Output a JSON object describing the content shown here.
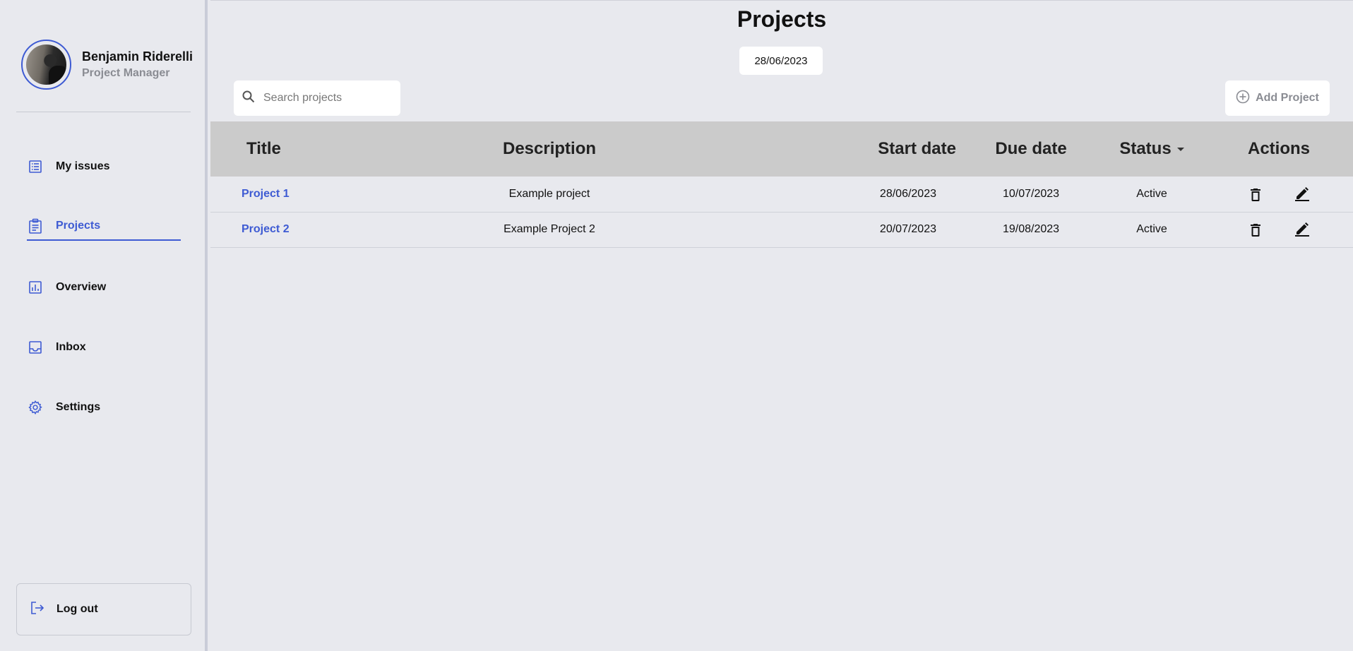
{
  "profile": {
    "name": "Benjamin Riderelli",
    "role": "Project Manager"
  },
  "sidebar": {
    "items": [
      {
        "label": "My issues",
        "icon": "list-icon"
      },
      {
        "label": "Projects",
        "icon": "clipboard-icon",
        "active": true
      },
      {
        "label": "Overview",
        "icon": "bar-chart-icon"
      },
      {
        "label": "Inbox",
        "icon": "inbox-icon"
      },
      {
        "label": "Settings",
        "icon": "gear-icon"
      }
    ],
    "logout_label": "Log out"
  },
  "main": {
    "title": "Projects",
    "date": "28/06/2023",
    "search_placeholder": "Search projects",
    "add_button_label": "Add Project"
  },
  "table": {
    "headers": [
      "Title",
      "Description",
      "Start date",
      "Due date",
      "Status",
      "Actions"
    ],
    "rows": [
      {
        "title": "Project 1",
        "description": "Example project",
        "start": "28/06/2023",
        "due": "10/07/2023",
        "status": "Active"
      },
      {
        "title": "Project 2",
        "description": "Example Project 2",
        "start": "20/07/2023",
        "due": "19/08/2023",
        "status": "Active"
      }
    ]
  },
  "colors": {
    "accent": "#3e5bd3",
    "background": "#e8e9ee",
    "header_bg": "#cbcbcb"
  }
}
